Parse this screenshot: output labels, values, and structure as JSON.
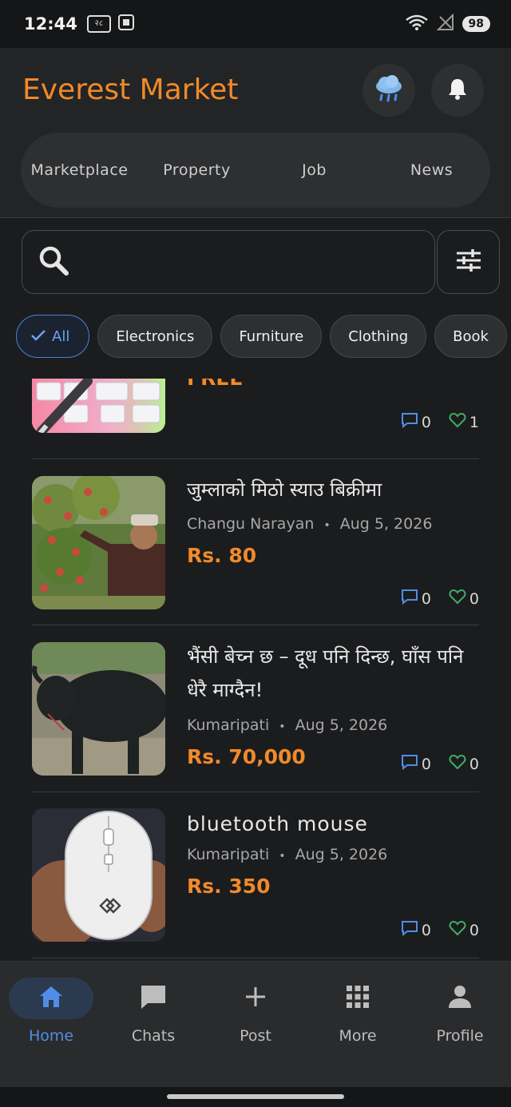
{
  "status_bar": {
    "time": "12:44",
    "icon_left_1": "२८",
    "battery": "98",
    "wifi_label": "5"
  },
  "header": {
    "title": "Everest Market",
    "weather_icon": "rain-cloud-icon",
    "bell_icon": "bell-icon",
    "tabs": [
      {
        "label": "Marketplace"
      },
      {
        "label": "Property"
      },
      {
        "label": "Job"
      },
      {
        "label": "News"
      }
    ]
  },
  "search": {
    "placeholder": ""
  },
  "chips": [
    {
      "label": "All",
      "selected": true
    },
    {
      "label": "Electronics",
      "selected": false
    },
    {
      "label": "Furniture",
      "selected": false
    },
    {
      "label": "Clothing",
      "selected": false
    },
    {
      "label": "Book",
      "selected": false
    }
  ],
  "listings": [
    {
      "title": "",
      "location": "",
      "date": "",
      "price": "FREE",
      "comments": "0",
      "likes": "1"
    },
    {
      "title": "जुम्लाको मिठो स्याउ बिक्रीमा",
      "location": "Changu Narayan",
      "date": "Aug 5, 2026",
      "price": "Rs. 80",
      "comments": "0",
      "likes": "0"
    },
    {
      "title": "भैंसी बेच्न छ – दूध पनि दिन्छ, घाँस पनि धेरै माग्दैन!",
      "location": "Kumaripati",
      "date": "Aug 5, 2026",
      "price": "Rs. 70,000",
      "comments": "0",
      "likes": "0"
    },
    {
      "title": "bluetooth mouse",
      "location": "Kumaripati",
      "date": "Aug 5, 2026",
      "price": "Rs. 350",
      "comments": "0",
      "likes": "0"
    }
  ],
  "meta_separator": "•",
  "bottom_nav": [
    {
      "label": "Home",
      "icon": "home-icon",
      "active": true
    },
    {
      "label": "Chats",
      "icon": "chat-icon",
      "active": false
    },
    {
      "label": "Post",
      "icon": "plus-icon",
      "active": false
    },
    {
      "label": "More",
      "icon": "grid-icon",
      "active": false
    },
    {
      "label": "Profile",
      "icon": "person-icon",
      "active": false
    }
  ],
  "colors": {
    "accent_orange": "#f08a2a",
    "accent_blue": "#4f8ee6",
    "like_green": "#3fae63",
    "background": "#1b1c1e"
  }
}
